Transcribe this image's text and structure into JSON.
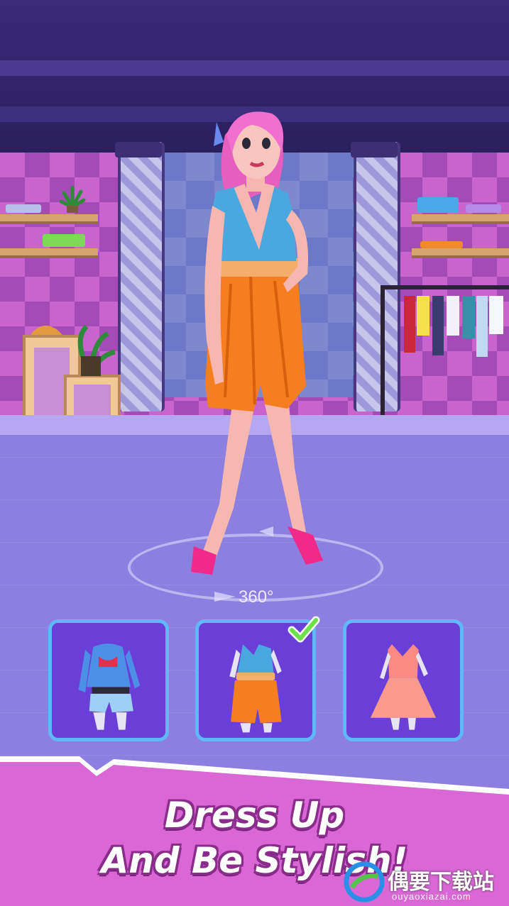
{
  "scene": {
    "rotate_label": "360°"
  },
  "outfits": [
    {
      "name": "denim-jacket-shorts",
      "selected": false
    },
    {
      "name": "blue-top-orange-skirt",
      "selected": true
    },
    {
      "name": "coral-dress",
      "selected": false
    }
  ],
  "banner": {
    "line1": "Dress Up",
    "line2": "And Be Stylish!"
  },
  "watermark": {
    "brand_cn": "偶要下载站",
    "url": "ouyaoxiazai.com"
  },
  "colors": {
    "accent_card": "#6a3fd8",
    "card_border": "#5fb8f8",
    "check": "#6ee04a",
    "banner_pink": "#e06fd8"
  }
}
